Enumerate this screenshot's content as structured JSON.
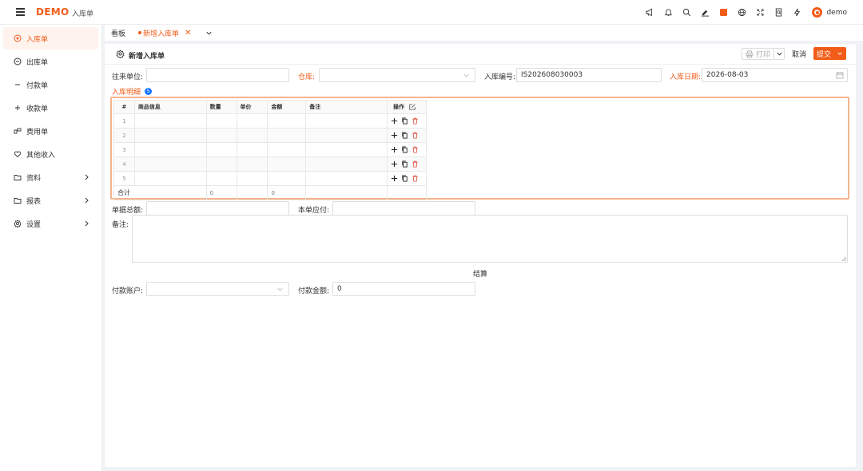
{
  "header": {
    "logo": "DEMO",
    "breadcrumb": "入库单",
    "user": "demo",
    "icons": [
      "megaphone-icon",
      "bell-icon",
      "search-icon",
      "edit-line-icon",
      "theme-color-icon",
      "globe-icon",
      "fullscreen-icon",
      "doc-search-icon",
      "bolt-icon"
    ],
    "accent": "#f25c19"
  },
  "sidebar": {
    "items": [
      {
        "label": "入库单",
        "icon": "plus-circle-icon",
        "active": true
      },
      {
        "label": "出库单",
        "icon": "minus-circle-icon"
      },
      {
        "label": "付款单",
        "icon": "minus-icon"
      },
      {
        "label": "收款单",
        "icon": "plus-icon"
      },
      {
        "label": "费用单",
        "icon": "cost-icon"
      },
      {
        "label": "其他收入",
        "icon": "heart-icon"
      },
      {
        "label": "资料",
        "icon": "folder-icon",
        "expandable": true
      },
      {
        "label": "报表",
        "icon": "folder-icon",
        "expandable": true
      },
      {
        "label": "设置",
        "icon": "gear-icon",
        "expandable": true
      }
    ]
  },
  "tabs": [
    {
      "label": "看板"
    },
    {
      "label": "新增入库单",
      "active": true
    }
  ],
  "card": {
    "title": "新增入库单",
    "print_label": "打印",
    "cancel_label": "取消",
    "submit_label": "提交"
  },
  "form": {
    "partner_label": "往来单位:",
    "partner_value": "",
    "warehouse_label": "仓库:",
    "warehouse_value": "",
    "code_label": "入库编号:",
    "code_value": "IS202608030003",
    "date_label": "入库日期:",
    "date_value": "2026-08-03",
    "section_label": "入库明细",
    "section_count": "5",
    "total_label": "单据总额:",
    "total_value": "",
    "payable_label": "本单应付:",
    "payable_value": "",
    "remark_label": "备注:",
    "settle_label": "结算",
    "account_label": "付款账户:",
    "account_value": "",
    "pay_amount_label": "付款金额:",
    "pay_amount_value": "0"
  },
  "grid": {
    "headers": [
      "#",
      "商品信息",
      "数量",
      "单价",
      "金额",
      "备注",
      "操作"
    ],
    "rows": [
      "1",
      "2",
      "3",
      "4",
      "5"
    ],
    "sum_label": "合计",
    "sum_qty": "0",
    "sum_amount": "0"
  }
}
